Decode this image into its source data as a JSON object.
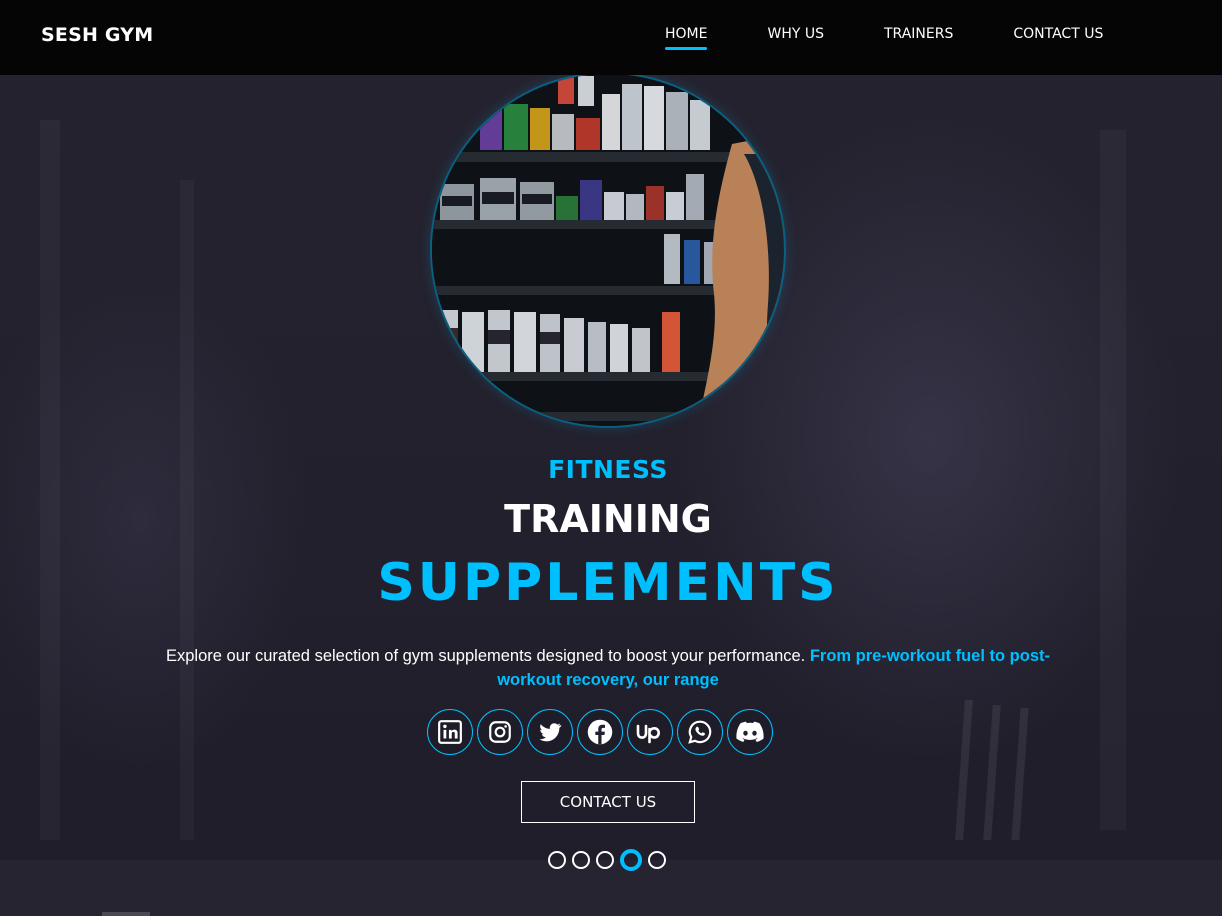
{
  "navbar": {
    "brand": "SESH GYM",
    "links": [
      {
        "label": "HOME",
        "active": true
      },
      {
        "label": "WHY US",
        "active": false
      },
      {
        "label": "TRAINERS",
        "active": false
      },
      {
        "label": "CONTACT US",
        "active": false
      }
    ]
  },
  "hero": {
    "image": "supplement-shelves-photo",
    "headline_small": "FITNESS",
    "headline_medium": "TRAINING",
    "headline_large": "SUPPLEMENTS",
    "description_plain": "Explore our curated selection of gym supplements designed to boost your performance. ",
    "description_highlight": "From pre-workout fuel to post-workout recovery, our range",
    "socials": [
      {
        "icon": "linkedin-icon"
      },
      {
        "icon": "instagram-icon"
      },
      {
        "icon": "twitter-icon"
      },
      {
        "icon": "facebook-icon"
      },
      {
        "icon": "upwork-icon"
      },
      {
        "icon": "whatsapp-icon"
      },
      {
        "icon": "discord-icon"
      }
    ],
    "cta_label": "CONTACT US",
    "slider": {
      "total": 5,
      "active_index": 3
    }
  },
  "colors": {
    "accent": "#00bfff",
    "navbar_bg": "#050505",
    "page_bg": "#23212d",
    "text": "#ffffff"
  }
}
